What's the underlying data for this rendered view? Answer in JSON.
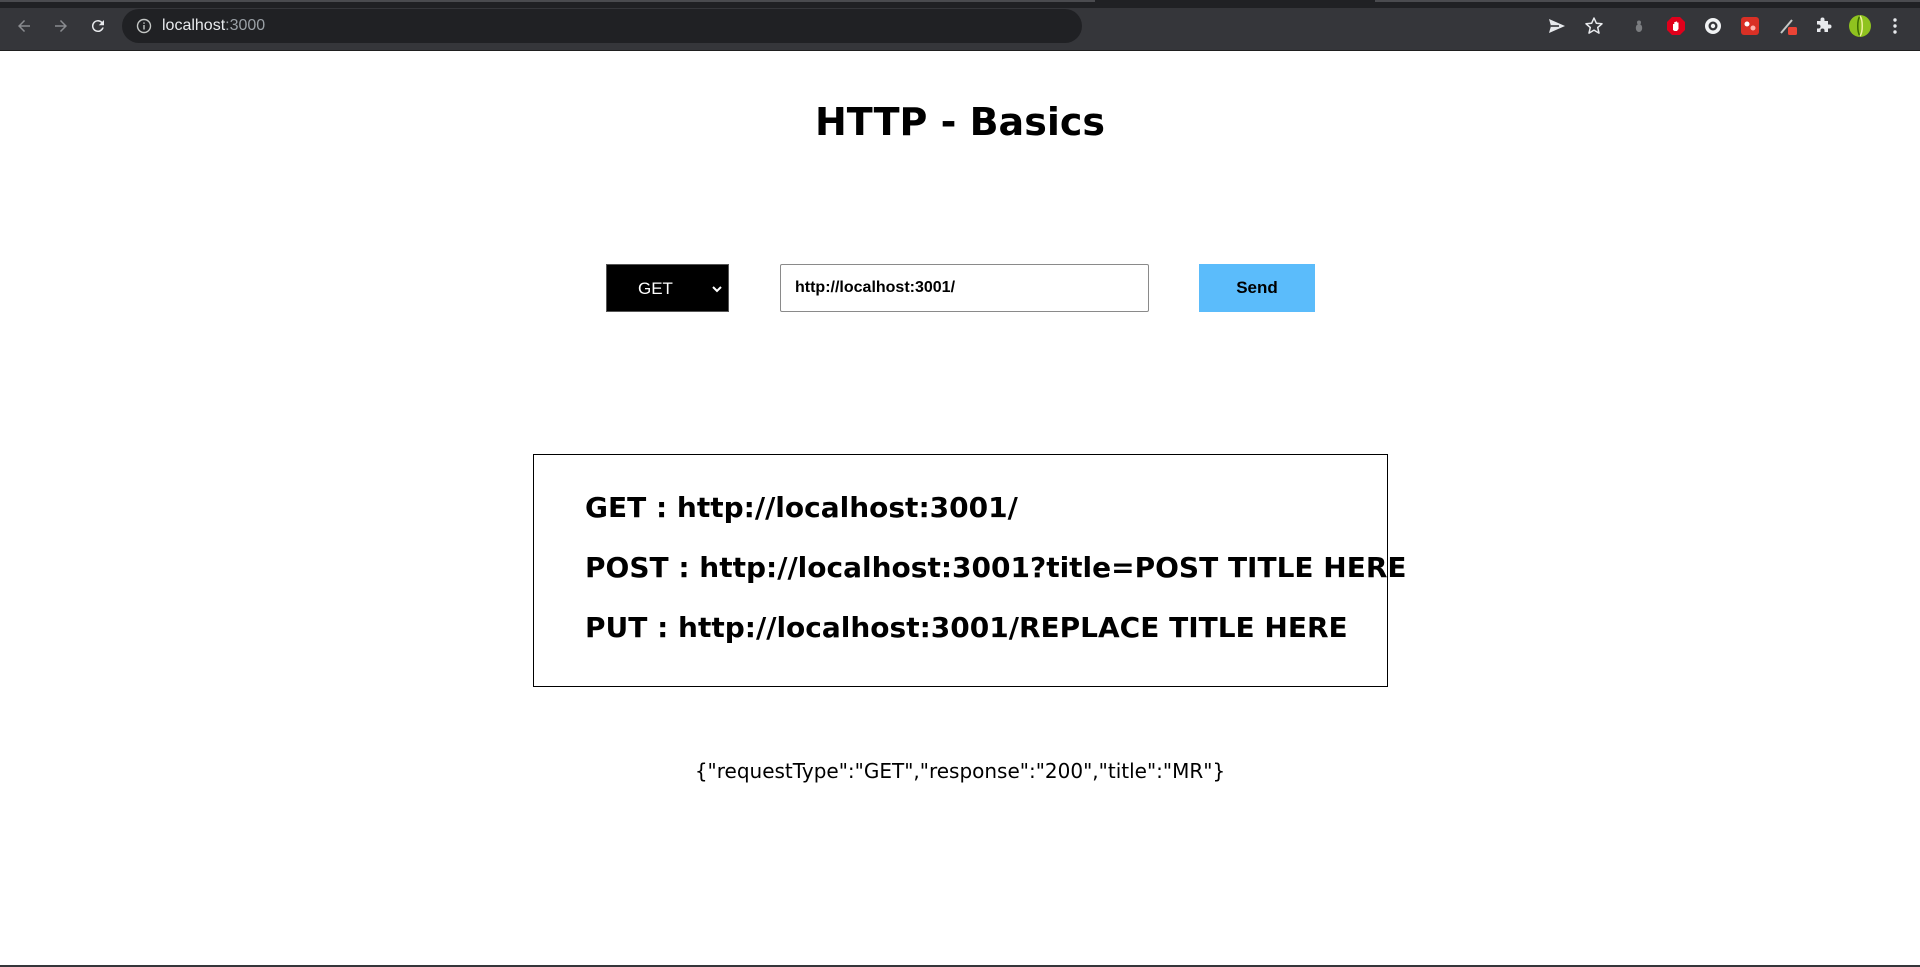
{
  "browser": {
    "url_host": "localhost",
    "url_port": ":3000"
  },
  "page": {
    "title": "HTTP - Basics",
    "method_select": {
      "selected": "GET"
    },
    "url_input": {
      "value": "http://localhost:3001/"
    },
    "send_label": "Send",
    "routes": [
      "GET : http://localhost:3001/",
      "POST : http://localhost:3001?title=POST TITLE HERE",
      "PUT : http://localhost:3001/REPLACE TITLE HERE"
    ],
    "response": "{\"requestType\":\"GET\",\"response\":\"200\",\"title\":\"MR\"}"
  },
  "colors": {
    "chrome_bg": "#35363a",
    "omnibox_bg": "#202124",
    "send_button": "#5bbcfb",
    "select_bg": "#000000"
  },
  "icons": {
    "nav": [
      "back-arrow-icon",
      "forward-arrow-icon",
      "reload-icon"
    ],
    "omnibox": "info-icon",
    "toolbar": [
      "send-tab-icon",
      "bookmark-star-icon",
      "extension-dot-icon",
      "stop-hand-icon",
      "circle-extension-icon",
      "red-extension-icon",
      "pen-extension-icon",
      "puzzle-icon",
      "profile-avatar-icon",
      "menu-dots-icon"
    ]
  }
}
